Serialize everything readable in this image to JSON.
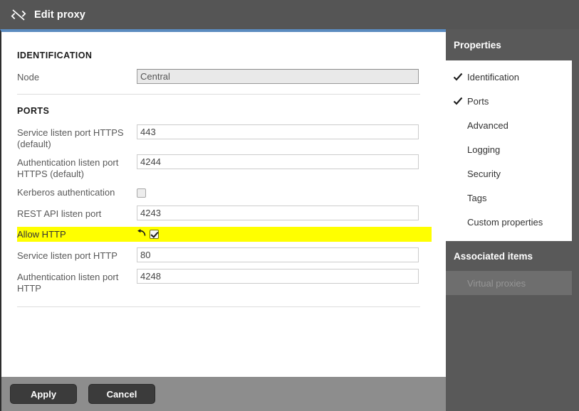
{
  "window": {
    "title": "Edit proxy",
    "title_icon": "proxy-collapse-arrows-icon",
    "accent_color": "#5b8bbf",
    "titlebar_color": "#555555",
    "panel_color": "#595959",
    "highlight_color": "#ffff00"
  },
  "form": {
    "identification": {
      "heading": "IDENTIFICATION",
      "fields": [
        {
          "label": "Node",
          "value": "Central",
          "type": "text",
          "disabled": true
        }
      ]
    },
    "ports": {
      "heading": "PORTS",
      "fields": [
        {
          "label": "Service listen port HTTPS (default)",
          "value": "443",
          "type": "text"
        },
        {
          "label": "Authentication listen port HTTPS (default)",
          "value": "4244",
          "type": "text"
        },
        {
          "label": "Kerberos authentication",
          "type": "checkbox",
          "checked": false
        },
        {
          "label": "REST API listen port",
          "value": "4243",
          "type": "text"
        },
        {
          "label": "Allow HTTP",
          "type": "checkbox",
          "checked": true,
          "highlighted": true,
          "undo_icon": "undo-arrow-icon"
        },
        {
          "label": "Service listen port HTTP",
          "value": "80",
          "type": "text"
        },
        {
          "label": "Authentication listen port HTTP",
          "value": "4248",
          "type": "text"
        }
      ]
    }
  },
  "footer": {
    "apply_label": "Apply",
    "cancel_label": "Cancel"
  },
  "properties": {
    "heading": "Properties",
    "items": [
      {
        "label": "Identification",
        "checked": true
      },
      {
        "label": "Ports",
        "checked": true
      },
      {
        "label": "Advanced",
        "checked": false
      },
      {
        "label": "Logging",
        "checked": false
      },
      {
        "label": "Security",
        "checked": false
      },
      {
        "label": "Tags",
        "checked": false
      },
      {
        "label": "Custom properties",
        "checked": false
      }
    ]
  },
  "associated": {
    "heading": "Associated items",
    "items": [
      {
        "label": "Virtual proxies",
        "disabled": true
      }
    ]
  }
}
